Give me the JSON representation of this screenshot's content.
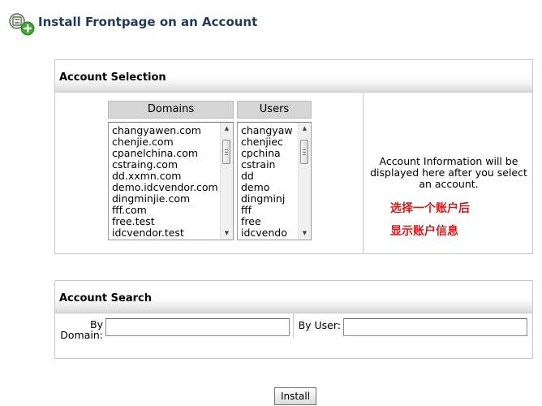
{
  "header": {
    "title": "Install Frontpage on an Account",
    "icon": "frontpage-install-icon"
  },
  "account_selection": {
    "heading": "Account Selection",
    "domains_header": "Domains",
    "users_header": "Users",
    "domains": [
      "changyawen.com",
      "chenjie.com",
      "cpanelchina.com",
      "cstraing.com",
      "dd.xxmn.com",
      "demo.idcvendor.com",
      "dingminjie.com",
      "fff.com",
      "free.test",
      "idcvendor.test"
    ],
    "users": [
      "changyaw",
      "chenjiec",
      "cpchina",
      "cstrain",
      "dd",
      "demo",
      "dingminj",
      "fff",
      "free",
      "idcvendo"
    ],
    "info_text": "Account Information will be displayed here after you select an account.",
    "note_line1": "选择一个账户后",
    "note_line2": "显示账户信息"
  },
  "account_search": {
    "heading": "Account Search",
    "by_domain_label_1": "By",
    "by_domain_label_2": "Domain:",
    "by_user_label": "By User:",
    "by_domain_value": "",
    "by_user_value": ""
  },
  "actions": {
    "install_label": "Install"
  },
  "colors": {
    "title": "#1f3a5a",
    "note": "#d61a1a",
    "panel_border": "#c9c9c9"
  }
}
